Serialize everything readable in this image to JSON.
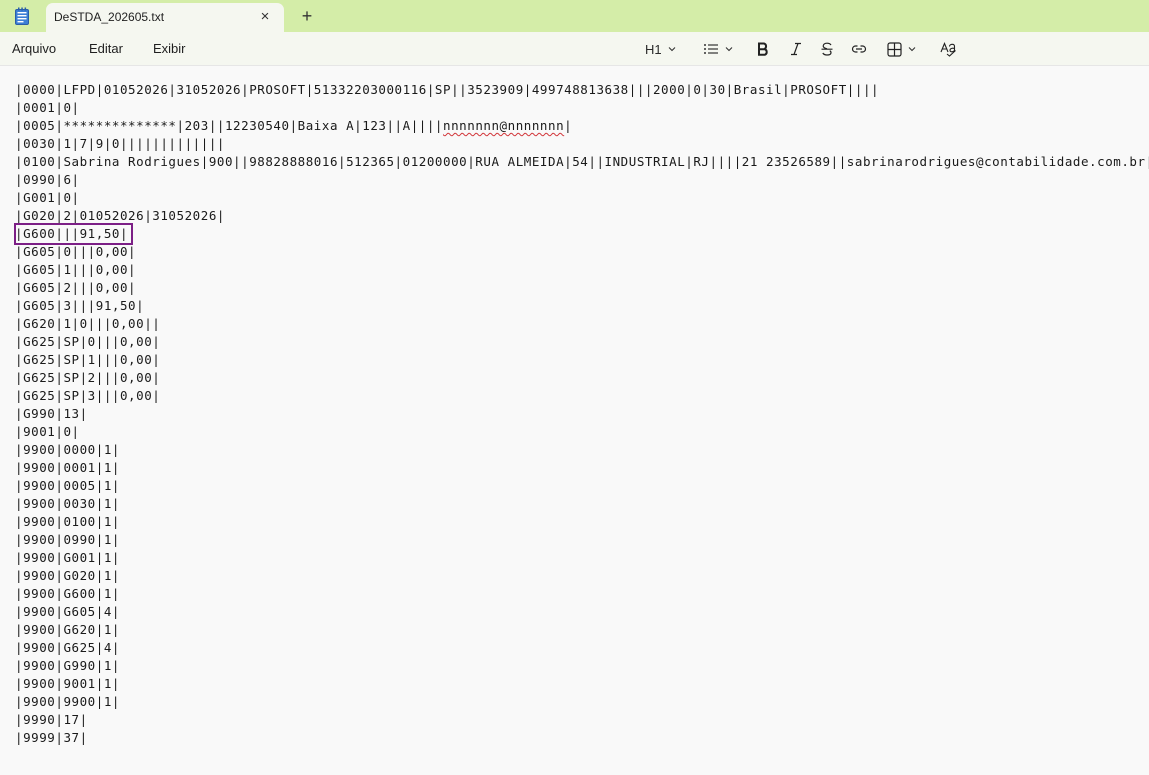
{
  "window": {
    "tab_title": "DeSTDA_202605.txt",
    "close_glyph": "×",
    "new_tab_glyph": "+"
  },
  "menu": {
    "file": "Arquivo",
    "edit": "Editar",
    "view": "Exibir"
  },
  "toolbar": {
    "heading_label": "H1",
    "icons": [
      "list-icon",
      "bold-icon",
      "italic-icon",
      "strikethrough-icon",
      "link-icon",
      "table-icon",
      "spellcheck-icon"
    ]
  },
  "document": {
    "lines": [
      "|0000|LFPD|01052026|31052026|PROSOFT|51332203000116|SP||3523909|499748813638|||2000|0|30|Brasil|PROSOFT||||",
      "|0001|0|",
      "|0005|**************|203||12230540|Baixa A|123||A||||",
      "|0030|1|7|9|0|||||||||||||",
      "|0100|Sabrina Rodrigues|900||98828888016|512365|01200000|RUA ALMEIDA|54||INDUSTRIAL|RJ||||21 23526589||sabrinarodrigues@contabilidade.com.br|",
      "|0990|6|",
      "|G001|0|",
      "|G020|2|01052026|31052026|",
      "|G600|||91,50|",
      "|G605|0|||0,00|",
      "|G605|1|||0,00|",
      "|G605|2|||0,00|",
      "|G605|3|||91,50|",
      "|G620|1|0|||0,00||",
      "|G625|SP|0|||0,00|",
      "|G625|SP|1|||0,00|",
      "|G625|SP|2|||0,00|",
      "|G625|SP|3|||0,00|",
      "|G990|13|",
      "|9001|0|",
      "|9900|0000|1|",
      "|9900|0001|1|",
      "|9900|0005|1|",
      "|9900|0030|1|",
      "|9900|0100|1|",
      "|9900|0990|1|",
      "|9900|G001|1|",
      "|9900|G020|1|",
      "|9900|G600|1|",
      "|9900|G605|4|",
      "|9900|G620|1|",
      "|9900|G625|4|",
      "|9900|G990|1|",
      "|9900|9001|1|",
      "|9900|9900|1|",
      "|9990|17|",
      "|9999|37|"
    ],
    "line3_email": "nnnnnnn@nnnnnnn",
    "line3_tail": "|"
  },
  "colors": {
    "titlebar": "#d4eda8",
    "highlight_border": "#7c1f86",
    "spell_error": "#d13438"
  }
}
